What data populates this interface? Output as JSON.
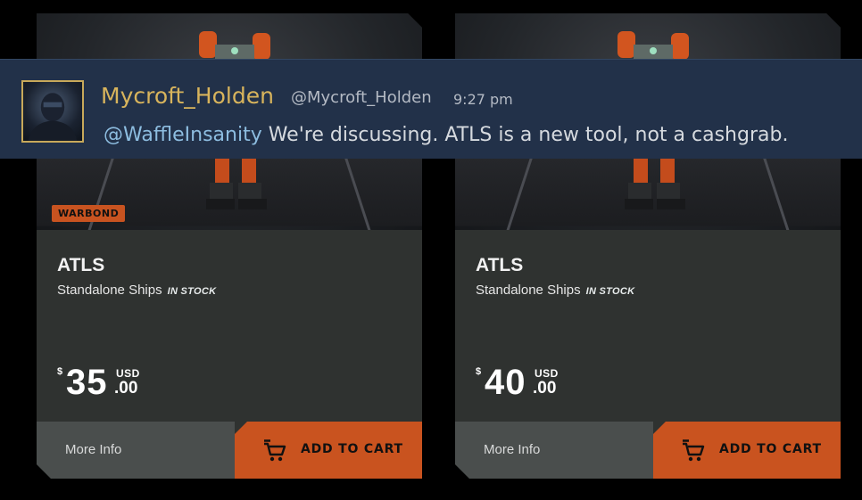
{
  "cards": [
    {
      "badge": "WARBOND",
      "title": "ATLS",
      "category": "Standalone Ships",
      "stock": "IN STOCK",
      "price": {
        "currency_symbol": "$",
        "whole": "35",
        "currency": "USD",
        "cents": ".00"
      },
      "more_info_label": "More Info",
      "add_to_cart_label": "ADD TO CART"
    },
    {
      "title": "ATLS",
      "category": "Standalone Ships",
      "stock": "IN STOCK",
      "price": {
        "currency_symbol": "$",
        "whole": "40",
        "currency": "USD",
        "cents": ".00"
      },
      "more_info_label": "More Info",
      "add_to_cart_label": "ADD TO CART"
    }
  ],
  "chat": {
    "username": "Mycroft_Holden",
    "handle": "@Mycroft_Holden",
    "time": "9:27 pm",
    "mention": "@WaffleInsanity",
    "message": " We're discussing. ATLS is a new tool, not a cashgrab."
  },
  "colors": {
    "accent": "#c9531f",
    "card_bg": "#2f3230",
    "chat_bg": "#223149",
    "username": "#d8b45c",
    "mention": "#8dbde0"
  },
  "icons": [
    "cart-icon",
    "mech-image",
    "avatar"
  ]
}
